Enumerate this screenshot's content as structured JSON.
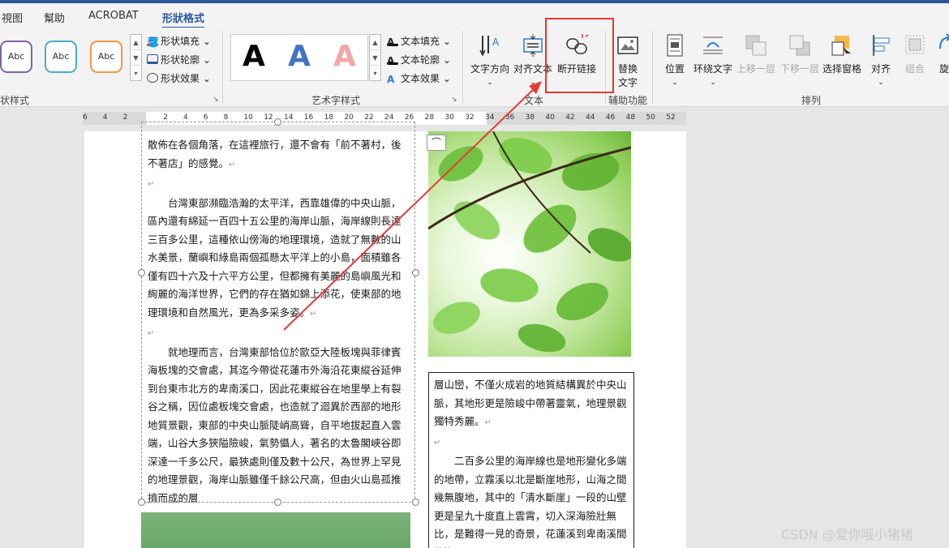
{
  "tabs": [
    "視图",
    "幫助",
    "ACROBAT",
    "形狀格式"
  ],
  "active_tab": "形狀格式",
  "ribbon": {
    "shape_styles": {
      "label": "状样式",
      "swatches": [
        {
          "text": "Abc",
          "color": "#8064a2"
        },
        {
          "text": "Abc",
          "color": "#4bacc6"
        },
        {
          "text": "Abc",
          "color": "#f79646"
        }
      ],
      "fill": "形状填充",
      "outline": "形状轮廓",
      "effects": "形状效果"
    },
    "wordart": {
      "label": "艺术字样式",
      "samples": [
        {
          "text": "A",
          "color": "#000000"
        },
        {
          "text": "A",
          "color": "#4472c4"
        },
        {
          "text": "A",
          "color": "#f4a6a6"
        }
      ],
      "text_fill": "文本填充",
      "text_outline": "文本轮廓",
      "text_effects": "文本效果"
    },
    "text_group": {
      "label": "文本",
      "direction": "文字方向",
      "align": "对齐文本",
      "break_link": "断开链接"
    },
    "accessibility": {
      "label": "辅助功能",
      "alt_text_line1": "替换",
      "alt_text_line2": "文字"
    },
    "arrange": {
      "label": "排列",
      "position": "位置",
      "wrap": "环绕文字",
      "bring_forward": "上移一层",
      "send_backward": "下移一层",
      "selection_pane": "选择窗格",
      "align": "对齐",
      "group": "组合",
      "rotate": "旋"
    }
  },
  "ruler": {
    "numbers": [
      "6",
      "4",
      "2",
      "",
      "2",
      "4",
      "6",
      "8",
      "10",
      "12",
      "14",
      "16",
      "18",
      "20",
      "22",
      "24",
      "26",
      "28",
      "30",
      "32",
      "34",
      "36",
      "38",
      "40",
      "42",
      "44",
      "46",
      "48",
      "50",
      "52"
    ]
  },
  "document": {
    "left_paragraphs": [
      "散佈在各個角落，在這裡旅行，還不會有「前不著村，後不著店」的感覺。",
      "台灣東部瀕臨浩瀚的太平洋，西靠雄偉的中央山脈，區內還有綿延一百四十五公里的海岸山脈，海岸線則長達三百多公里，這種依山傍海的地理環境，造就了無數的山水美景，蘭嶼和綠島兩個孤懸太平洋上的小島，面積雖各僅有四十六及十六平方公里，但都擁有美麗的島嶼風光和絢麗的海洋世界，它們的存在猶如錦上添花，使東部的地理環境和自然風光，更為多采多姿。",
      "就地理而言，台灣東部恰位於歐亞大陸板塊與菲律賓海板塊的交會處，其迄今帶從花蓮市外海沿花東縱谷延伸到台東市北方的卑南溪口，因此花東縱谷在地里學上有裂谷之稱，因位處板塊交會處，也造就了迴異於西部的地形地質景觀，東部的中央山脈陡峭高聳，自平地拔起直入雲端，山谷大多狹隘險峻，氣勢懾人，著名的太魯閣峽谷即深達一千多公尺，最狹處則僅及數十公尺，為世界上罕見的地理景觀，海岸山脈雖僅千餘公尺高，但由火山島孤推擠而成的層"
    ],
    "right_paragraphs": [
      "層山巒，不僅火成岩的地質結構異於中央山脈，其地形更是險峻中帶著靈氣，地理景觀獨特秀麗。",
      "二百多公里的海岸線也是地形變化多端的地帶，立霧溪以北是斷崖地形，山海之間幾無腹地，其中的「清水斷崖」一段的山壁更是呈九十度直上雲霄，切入深海險壯無比，是難得一見的奇景，花蓮溪到卑南溪間的海"
    ]
  },
  "watermark": "CSDN @爱你哦小猪猪"
}
